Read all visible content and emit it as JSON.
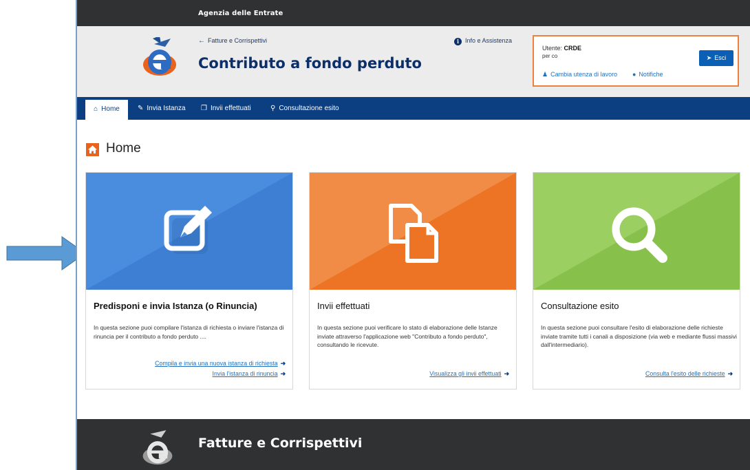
{
  "agency_name": "Agenzia delle Entrate",
  "header": {
    "back_link": "Fatture e Corrispettivi",
    "app_title": "Contributo a fondo perduto",
    "info_link": "Info e Assistenza"
  },
  "user_box": {
    "user_label": "Utente:",
    "user_name": "CRDE",
    "per_text": "per co",
    "exit_label": "Esci",
    "change_link": "Cambia utenza di lavoro",
    "notifications_link": "Notifiche"
  },
  "nav": {
    "items": [
      {
        "label": "Home",
        "icon": "home-icon"
      },
      {
        "label": "Invia Istanza",
        "icon": "edit-icon"
      },
      {
        "label": "Invii effettuati",
        "icon": "copy-icon"
      },
      {
        "label": "Consultazione esito",
        "icon": "search-icon"
      }
    ]
  },
  "page": {
    "heading": "Home"
  },
  "cards": [
    {
      "title": "Predisponi e invia Istanza (o Rinuncia)",
      "text": "In questa sezione puoi compilare l'istanza di richiesta o inviare l'istanza di rinuncia per il contributo a fondo perduto ....",
      "links": [
        "Compila e invia una nuova istanza di richiesta",
        "Invia l'istanza di rinuncia"
      ],
      "icon": "edit-icon",
      "color": "#4a8ddf"
    },
    {
      "title": "Invii effettuati",
      "text": "In questa sezione puoi verificare lo stato di elaborazione delle Istanze inviate attraverso l'applicazione web \"Contributo a fondo perduto\", consultando le ricevute.",
      "links": [
        "Visualizza gli invii effettuati"
      ],
      "icon": "copy-icon",
      "color": "#ee7a2f"
    },
    {
      "title": "Consultazione esito",
      "text": "In questa sezione puoi consultare l'esito di elaborazione delle richieste inviate tramite tutti i canali a disposizione (via web e mediante flussi massivi dall'intermediario).",
      "links": [
        "Consulta l'esito delle richieste"
      ],
      "icon": "search-icon",
      "color": "#8cc251"
    }
  ],
  "footer": {
    "title": "Fatture e Corrispettivi"
  },
  "colors": {
    "topbar": "#2f3133",
    "nav": "#0c3f82",
    "accent_orange": "#ee7f3d",
    "link_blue": "#1e6fc0"
  }
}
